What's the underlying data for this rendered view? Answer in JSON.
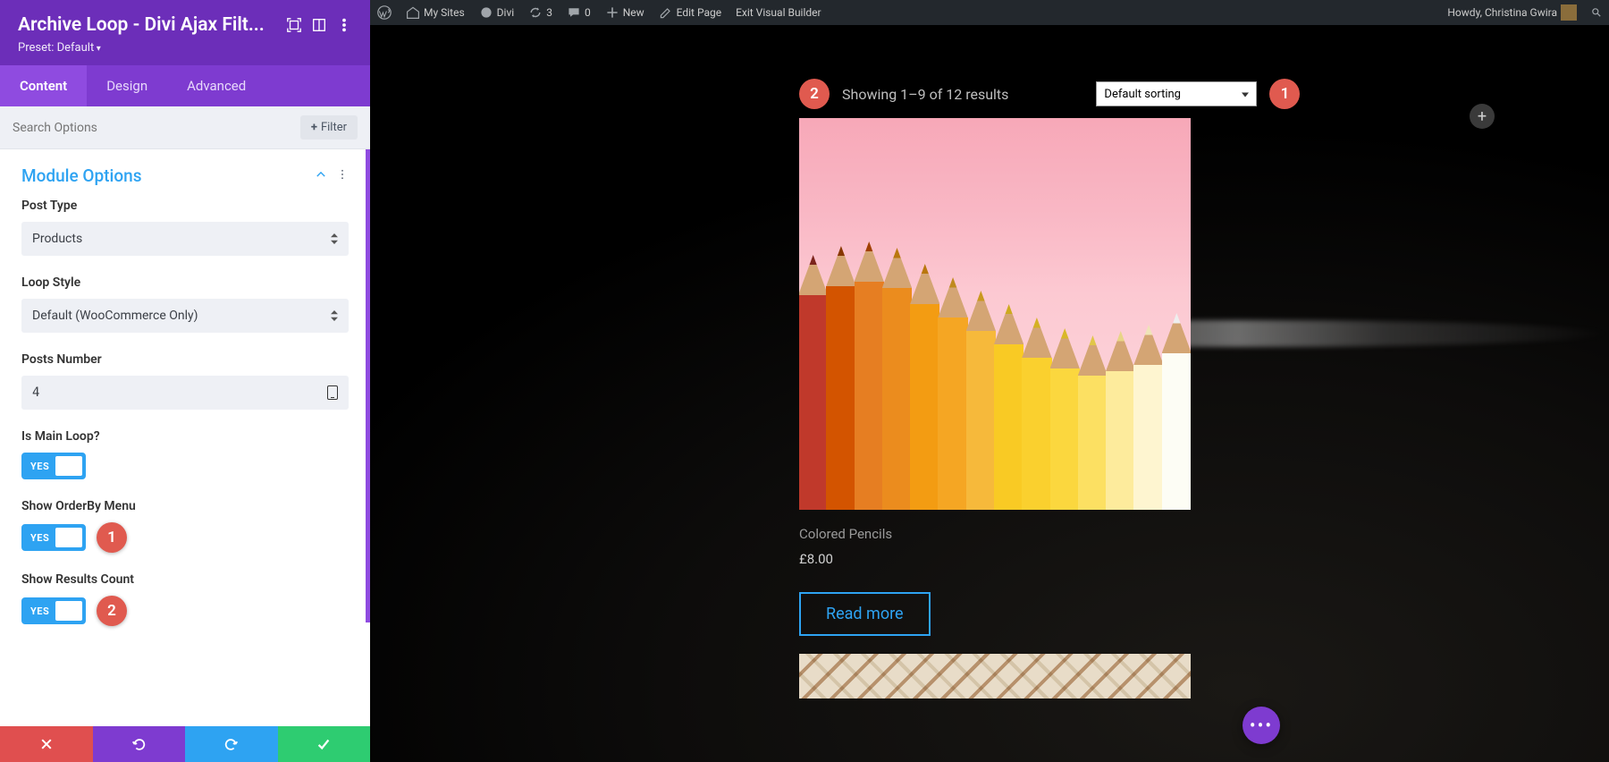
{
  "admin_bar": {
    "my_sites": "My Sites",
    "site_name": "Divi",
    "updates": "3",
    "comments": "0",
    "new": "New",
    "edit_page": "Edit Page",
    "exit_vb": "Exit Visual Builder",
    "howdy": "Howdy, Christina Gwira"
  },
  "sidebar": {
    "title": "Archive Loop - Divi Ajax Filt...",
    "preset": "Preset: Default",
    "tabs": {
      "content": "Content",
      "design": "Design",
      "advanced": "Advanced"
    },
    "search_placeholder": "Search Options",
    "filter_btn": "Filter",
    "section_title": "Module Options",
    "fields": {
      "post_type": {
        "label": "Post Type",
        "value": "Products"
      },
      "loop_style": {
        "label": "Loop Style",
        "value": "Default (WooCommerce Only)"
      },
      "posts_number": {
        "label": "Posts Number",
        "value": "4"
      },
      "is_main_loop": {
        "label": "Is Main Loop?",
        "toggle": "YES"
      },
      "show_orderby": {
        "label": "Show OrderBy Menu",
        "toggle": "YES",
        "badge": "1"
      },
      "show_results": {
        "label": "Show Results Count",
        "toggle": "YES",
        "badge": "2"
      }
    }
  },
  "preview": {
    "results_badge": "2",
    "results_text": "Showing 1–9 of 12 results",
    "sort_label": "Default sorting",
    "sort_badge": "1",
    "product": {
      "title": "Colored Pencils",
      "price": "£8.00",
      "cta": "Read more"
    }
  }
}
